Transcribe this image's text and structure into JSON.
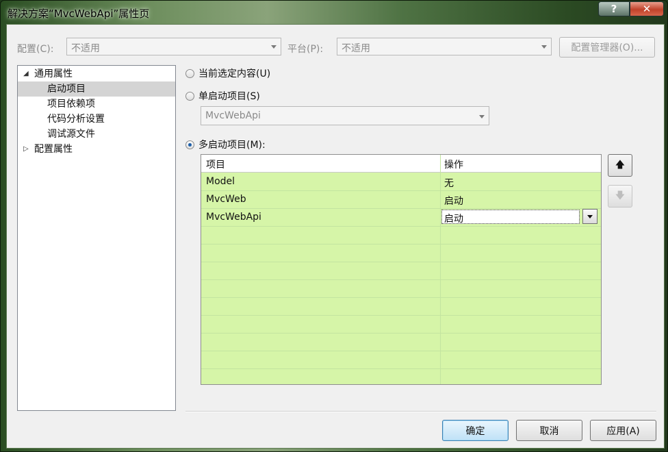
{
  "window": {
    "title": "解决方案“MvcWebApi”属性页"
  },
  "caption": {
    "help": "?",
    "close": "✕"
  },
  "toolbar": {
    "config_label": "配置(C):",
    "config_value": "不适用",
    "platform_label": "平台(P):",
    "platform_value": "不适用",
    "config_manager": "配置管理器(O)..."
  },
  "tree": {
    "items": [
      {
        "label": "通用属性",
        "toggle": "◢"
      },
      {
        "label": "启动项目"
      },
      {
        "label": "项目依赖项"
      },
      {
        "label": "代码分析设置"
      },
      {
        "label": "调试源文件"
      },
      {
        "label": "配置属性",
        "toggle": "▷"
      }
    ]
  },
  "options": {
    "current_selection": "当前选定内容(U)",
    "single_startup": "单启动项目(S)",
    "single_startup_value": "MvcWebApi",
    "multiple_startup": "多启动项目(M):"
  },
  "grid": {
    "headers": [
      "项目",
      "操作"
    ],
    "rows": [
      {
        "project": "Model",
        "action": "无"
      },
      {
        "project": "MvcWeb",
        "action": "启动"
      },
      {
        "project": "MvcWebApi",
        "action": "启动"
      }
    ]
  },
  "move_buttons": {
    "up": "🡅",
    "down": "🡇"
  },
  "buttons": {
    "ok": "确定",
    "cancel": "取消",
    "apply": "应用(A)"
  }
}
